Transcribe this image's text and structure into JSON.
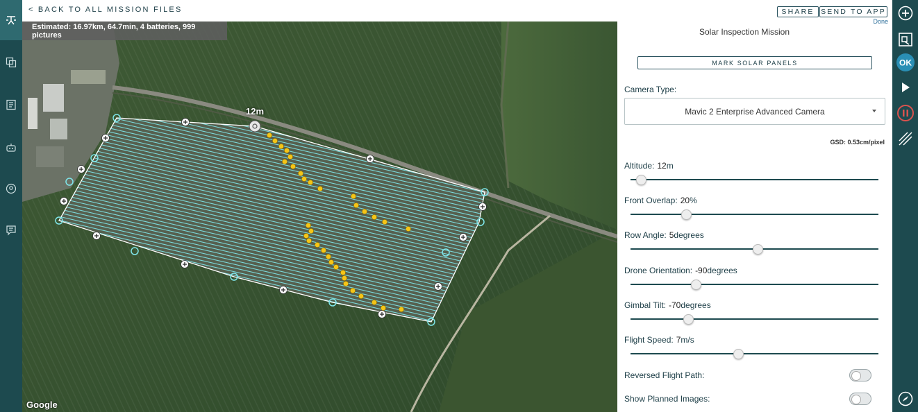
{
  "topbar": {
    "back_label": "< BACK TO ALL MISSION FILES",
    "share_label": "SHARE",
    "send_label": "SEND TO APP"
  },
  "map": {
    "estimate": "Estimated: 16.97km, 64.7min, 4 batteries, 999 pictures",
    "altitude_marker": "12m",
    "google_logo": "Google",
    "path_color": "#7fe6ea",
    "panel_dot_color": "#f5c518"
  },
  "panel": {
    "done_label": "Done",
    "mission_title": "Solar Inspection Mission",
    "mark_button": "MARK SOLAR PANELS",
    "camera_label": "Camera Type:",
    "camera_value": "Mavic 2 Enterprise Advanced Camera",
    "gsd": "GSD: 0.53cm/pixel",
    "settings": [
      {
        "label": "Altitude:",
        "value": "12",
        "unit": "m",
        "fraction": 0.04
      },
      {
        "label": "Front Overlap:",
        "value": "20",
        "unit": "%",
        "fraction": 0.22
      },
      {
        "label": "Row Angle:",
        "value": "5",
        "unit": "degrees",
        "fraction": 0.51
      },
      {
        "label": "Drone Orientation:",
        "value": "-90",
        "unit": "degrees",
        "fraction": 0.26
      },
      {
        "label": "Gimbal Tilt:",
        "value": "-70",
        "unit": "degrees",
        "fraction": 0.23
      },
      {
        "label": "Flight Speed:",
        "value": "7",
        "unit": "m/s",
        "fraction": 0.43
      }
    ],
    "reversed_label": "Reversed Flight Path:",
    "show_images_label": "Show Planned Images:"
  },
  "colors": {
    "rail": "#1d4a4f",
    "accent_red": "#d9534f",
    "accent_blue": "#2a8fb5"
  },
  "icons": {
    "left_rail": [
      "drone-path-icon",
      "copy-icon",
      "list-icon",
      "robot-icon",
      "user-circle-icon",
      "chat-icon"
    ],
    "right_rail": [
      "add-circle-icon",
      "map-select-icon",
      "ok-icon",
      "play-icon",
      "pause-icon",
      "route-icon",
      "compass-icon"
    ]
  }
}
